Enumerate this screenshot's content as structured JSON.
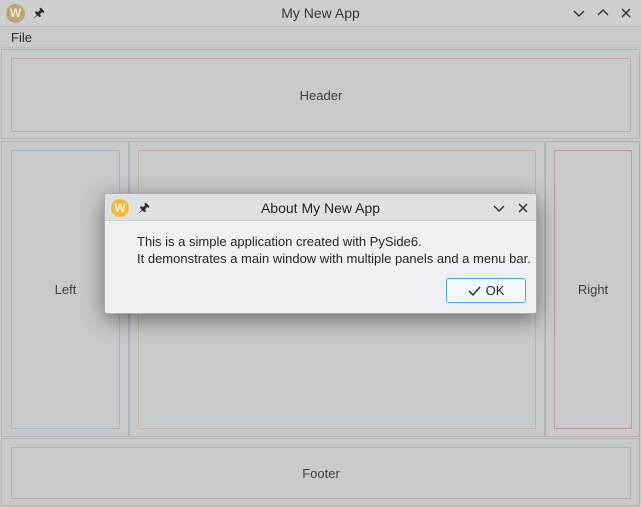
{
  "window": {
    "title": "My New App",
    "logo_letter": "W",
    "pin_icon": "pin-icon",
    "controls": [
      "chevron-down-icon",
      "chevron-up-icon",
      "close-icon"
    ]
  },
  "menubar": {
    "items": [
      "File"
    ]
  },
  "panels": {
    "header": "Header",
    "left": "Left",
    "right": "Right",
    "footer": "Footer"
  },
  "dialog": {
    "title": "About My New App",
    "logo_letter": "W",
    "line1": "This is a simple application created with PySide6.",
    "line2": "It demonstrates a main window with multiple panels and a menu bar.",
    "ok_label": "OK"
  },
  "colors": {
    "accent": "#3daee9",
    "dialog_logo": "#f4b73a"
  }
}
